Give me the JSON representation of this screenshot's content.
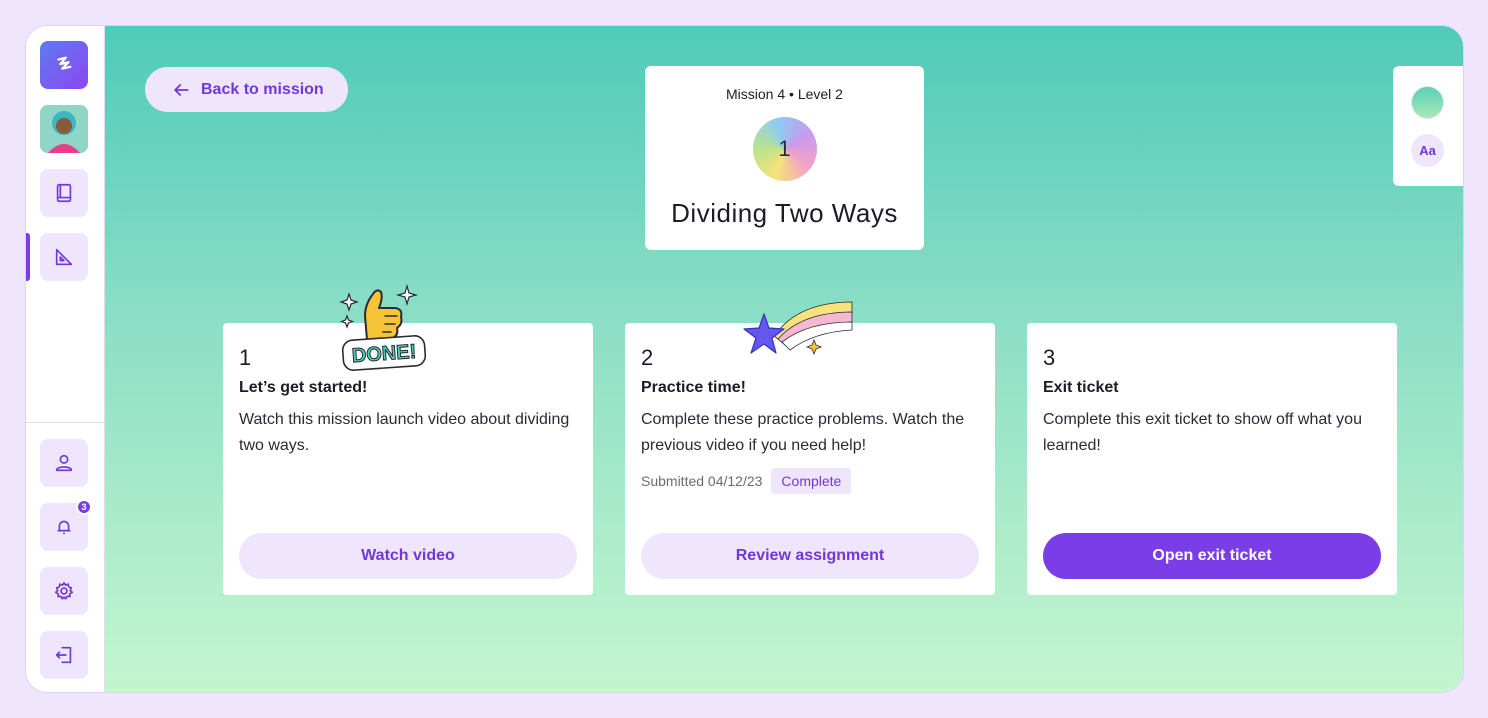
{
  "sidebar": {
    "icons": [
      "logo-icon",
      "avatar",
      "book-icon",
      "ruler-icon",
      "user-icon",
      "bell-icon",
      "gear-icon",
      "logout-icon"
    ],
    "notification_count": "3"
  },
  "header": {
    "back_label": "Back to mission",
    "mission_meta": "Mission 4 • Level 2",
    "level_number": "1",
    "mission_title": "Dividing Two Ways"
  },
  "tools": {
    "font_label": "Aa"
  },
  "cards": [
    {
      "number": "1",
      "title": "Let’s get started!",
      "description": "Watch this mission launch video about dividing two ways.",
      "button": "Watch video"
    },
    {
      "number": "2",
      "title": "Practice time!",
      "description": "Complete these practice problems. Watch the previous video if you need help!",
      "submitted": "Submitted 04/12/23",
      "status": "Complete",
      "button": "Review assignment"
    },
    {
      "number": "3",
      "title": "Exit ticket",
      "description": "Complete this exit ticket to show off what you learned!",
      "button": "Open exit ticket"
    }
  ],
  "stickers": {
    "done_text": "DONE!"
  },
  "colors": {
    "accent": "#7a3de8",
    "accent_light": "#efe6fd",
    "page_bg": "#efe6fd",
    "gradient_top": "#4fcaba",
    "gradient_bottom": "#c4f6cf"
  }
}
